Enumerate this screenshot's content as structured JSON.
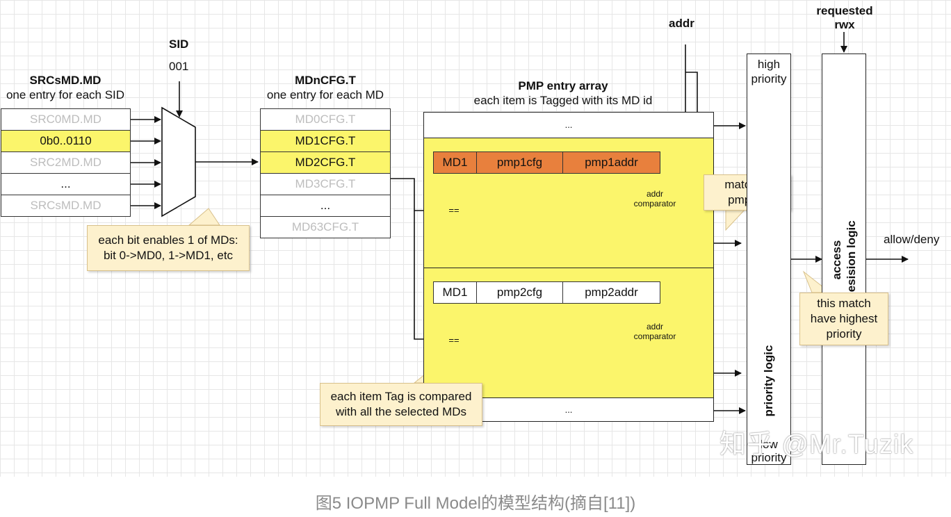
{
  "labels": {
    "sid_title": "SID",
    "sid_value": "001",
    "srcsmd_title": "SRCsMD.MD",
    "srcsmd_sub": "one entry for each SID",
    "mdncfg_title": "MDnCFG.T",
    "mdncfg_sub": "one entry for each MD",
    "pmp_title": "PMP entry array",
    "pmp_sub": "each item is Tagged with its MD id",
    "addr": "addr",
    "requested": "requested",
    "rwx": "rwx",
    "allow_deny": "allow/deny",
    "high": "high",
    "priority_top": "priority",
    "low": "low",
    "priority_bottom": "priority",
    "priority_logic": "priority logic",
    "access_line1": "access",
    "access_line2": "desision logic",
    "ellipsis_top": "...",
    "ellipsis_bottom": "..."
  },
  "srcsmd_rows": [
    "SRC0MD.MD",
    "0b0..0110",
    "SRC2MD.MD",
    "...",
    "SRCsMD.MD"
  ],
  "mdncfg_rows": [
    "MD0CFG.T",
    "MD1CFG.T",
    "MD2CFG.T",
    "MD3CFG.T",
    "...",
    "MD63CFG.T"
  ],
  "entries": [
    {
      "md": "MD1",
      "cfg": "pmp1cfg",
      "addr": "pmp1addr",
      "eq": "==",
      "cmp1": "addr",
      "cmp2": "comparator"
    },
    {
      "md": "MD1",
      "cfg": "pmp2cfg",
      "addr": "pmp2addr",
      "eq": "==",
      "cmp1": "addr",
      "cmp2": "comparator"
    }
  ],
  "notes": {
    "bits_line1": "each bit enables 1 of MDs:",
    "bits_line2": "bit 0->MD0, 1->MD1, etc",
    "tag_line1": "each item Tag is compared",
    "tag_line2": "with all the selected MDs",
    "matched_line1": "matched",
    "matched_line2": "pmpcfg",
    "highest_line1": "this match",
    "highest_line2": "have highest",
    "highest_line3": "priority"
  },
  "colors": {
    "highlight": "#fbf56b",
    "entry_orange": "#e8803d",
    "note_bg": "#fdf1cd",
    "caption": "#8a8a8a"
  },
  "watermark": "知乎 @Mr.Tuzik",
  "caption": "图5 IOPMP Full Model的模型结构(摘自[11])"
}
